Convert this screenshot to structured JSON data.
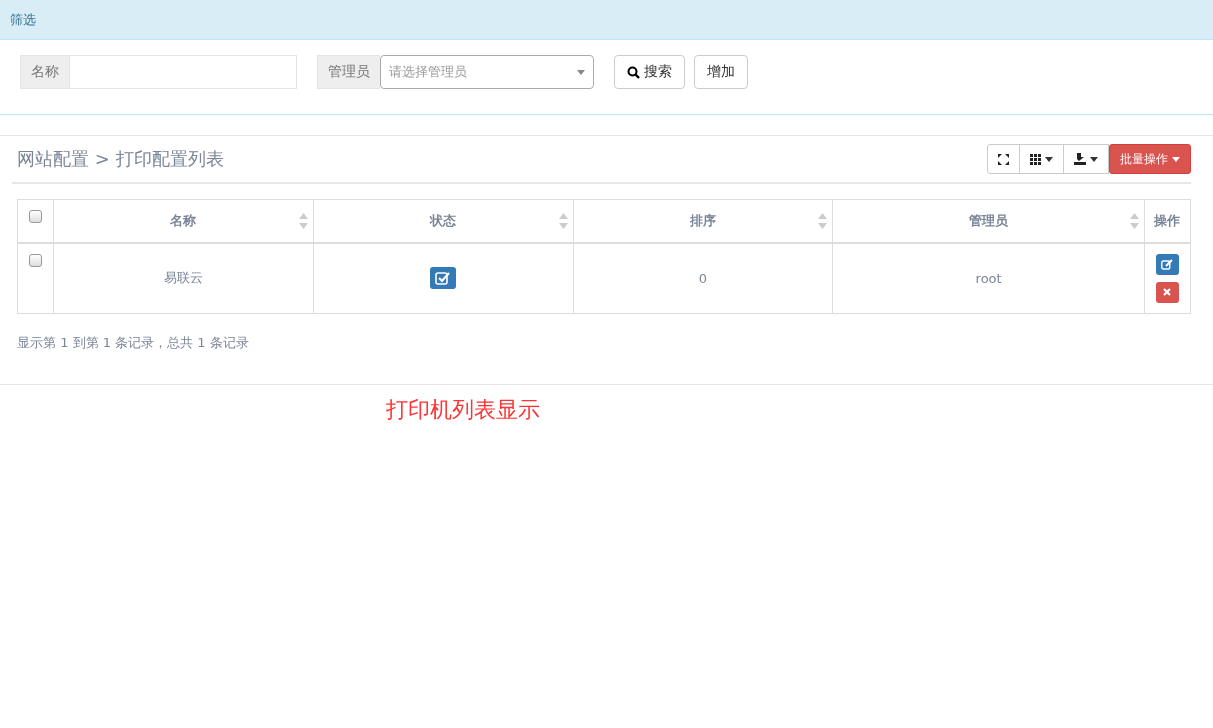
{
  "filter_panel": {
    "title": "筛选",
    "name_field": {
      "label": "名称"
    },
    "admin_select": {
      "label": "管理员",
      "placeholder": "请选择管理员"
    },
    "buttons": [
      {
        "kind": "search",
        "label": "搜索"
      },
      {
        "kind": "plain",
        "label": "增加"
      }
    ]
  },
  "breadcrumb": {
    "parent": "网站配置",
    "separator": ">",
    "current": "打印配置列表"
  },
  "toolbar": {
    "batch_button": "批量操作"
  },
  "table": {
    "select_all_checked": false,
    "columns": [
      {
        "label": "名称",
        "sortable": true
      },
      {
        "label": "状态",
        "sortable": true
      },
      {
        "label": "排序",
        "sortable": true
      },
      {
        "label": "管理员",
        "sortable": true
      },
      {
        "label": "操作",
        "sortable": false
      }
    ],
    "rows": [
      {
        "checked": false,
        "name": "易联云",
        "status_on": true,
        "sort": "0",
        "admin": "root"
      }
    ]
  },
  "pagination_info": "显示第 1 到第 1 条记录，总共 1 条记录",
  "annotation": "打印机列表显示"
}
